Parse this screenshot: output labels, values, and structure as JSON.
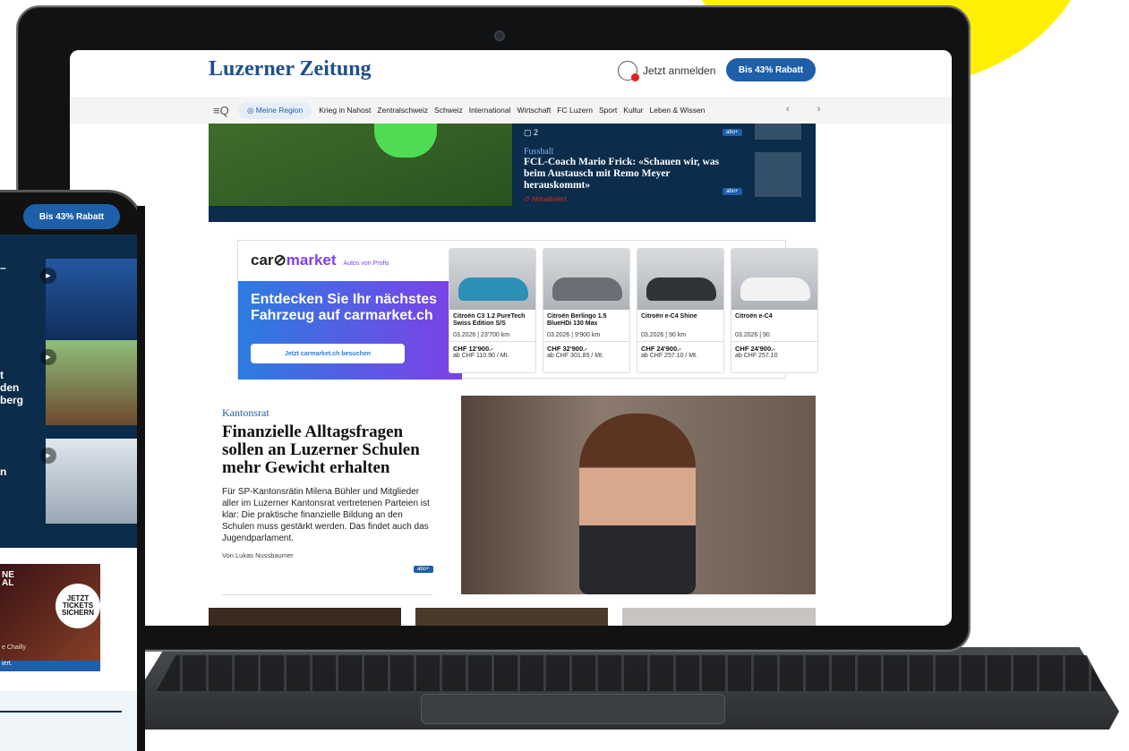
{
  "site": {
    "logo": "Luzerner Zeitung",
    "login": "Jetzt anmelden",
    "promo": "Bis 43% Rabatt"
  },
  "nav": {
    "menu_icon": "≡Q",
    "region": "Meine Region",
    "items": [
      "Krieg in Nahost",
      "Zentralschweiz",
      "Schweiz",
      "International",
      "Wirtschaft",
      "FC Luzern",
      "Sport",
      "Kultur",
      "Leben & Wissen"
    ],
    "arrows": "‹ ›"
  },
  "hero": {
    "comments": "2",
    "section": "Fussball",
    "headline": "FCL-Coach Mario Frick: «Schauen wir, was beim Austausch mit Remo Meyer herauskommt»",
    "updated": "Aktualisiert",
    "badge": "abo+"
  },
  "ad": {
    "brand_a": "car",
    "brand_b": "market",
    "brand_sub": "Autos von Profis",
    "title": "Entdecken Sie Ihr nächstes Fahrzeug auf carmarket.ch",
    "button": "Jetzt carmarket.ch besuchen",
    "cars": [
      {
        "name": "Citroën C3 1.2 PureTech Swiss Edition S/S",
        "spec": "03.2026 | 23'700 km",
        "price": "CHF 12'900.-",
        "rate": "ab CHF 110.90 / Mt.",
        "color": "#2c8fb8"
      },
      {
        "name": "Citroën Berlingo 1.5 BlueHDi 130 Max",
        "spec": "03.2026 | 9'900 km",
        "price": "CHF 32'900.-",
        "rate": "ab CHF 301.85 / Mt.",
        "color": "#6a6f75"
      },
      {
        "name": "Citroën e-C4 Shine",
        "spec": "03.2026 | 90 km",
        "price": "CHF 24'900.-",
        "rate": "ab CHF 257.10 / Mt.",
        "color": "#2f3438"
      },
      {
        "name": "Citroën e-C4",
        "spec": "03.2026 | 90",
        "price": "CHF 24'900.-",
        "rate": "ab CHF 257.10",
        "color": "#f2f2f2"
      }
    ]
  },
  "article": {
    "category": "Kantonsrat",
    "headline": "Finanzielle Alltagsfragen sollen an Luzerner Schulen mehr Gewicht erhalten",
    "lead": "Für SP-Kantonsrätin Milena Bühler und Mitglieder aller im Luzerner Kantonsrat vertretenen Parteien ist klar: Die praktische finanzielle Bildung an den Schulen muss gestärkt werden. Das findet auch das Jugendparlament.",
    "byline": "Von Lukas Nussbaumer",
    "badge": "abo+"
  },
  "phone": {
    "promo": "Bis 43% Rabatt",
    "item1": "–",
    "item2": "t\nden\nberg",
    "item3": "n",
    "ad_top": "NE\nAL",
    "ad_badge": "JETZT TICKETS SICHERN",
    "ad_caption": "e Chailly",
    "ad_foot": "iert."
  }
}
